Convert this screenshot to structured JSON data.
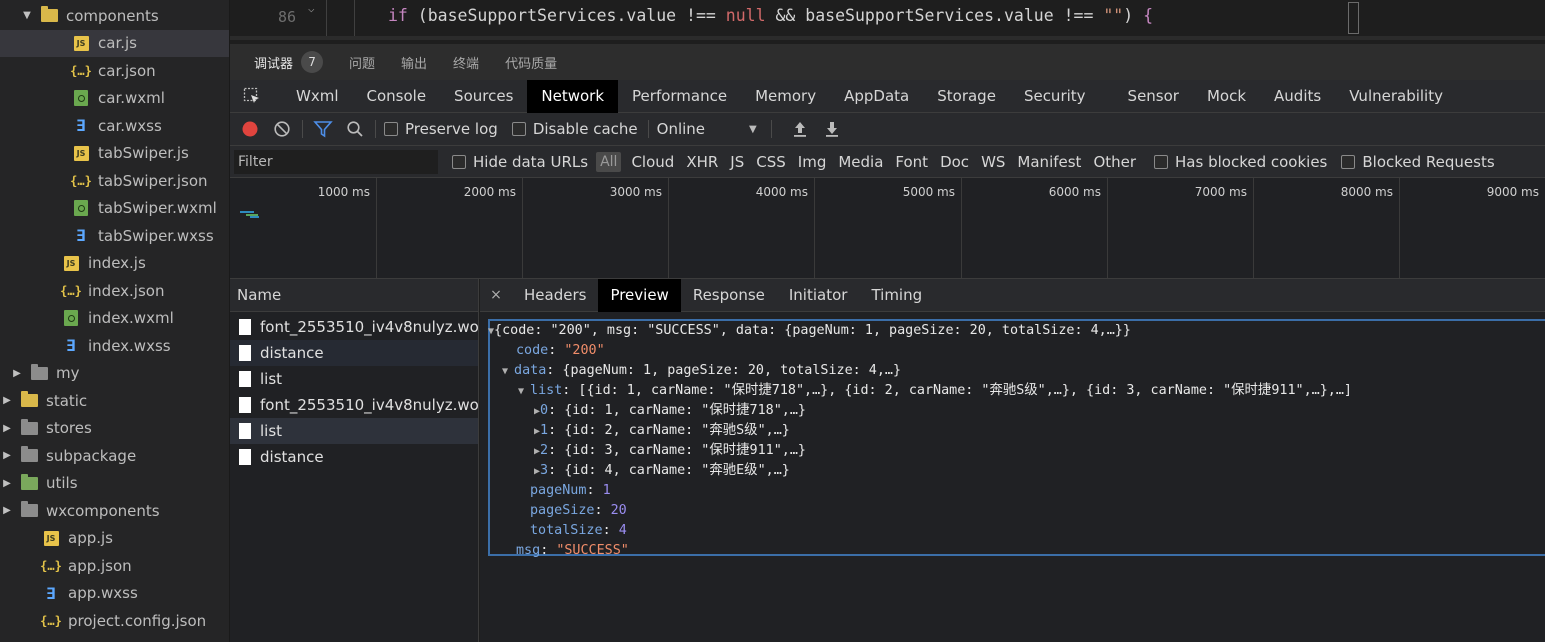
{
  "explorer": {
    "items": [
      {
        "label": "components",
        "type": "folder-yellow",
        "expanded": true
      },
      {
        "label": "car.js",
        "type": "js"
      },
      {
        "label": "car.json",
        "type": "json"
      },
      {
        "label": "car.wxml",
        "type": "wxml"
      },
      {
        "label": "car.wxss",
        "type": "wxss"
      },
      {
        "label": "tabSwiper.js",
        "type": "js"
      },
      {
        "label": "tabSwiper.json",
        "type": "json"
      },
      {
        "label": "tabSwiper.wxml",
        "type": "wxml"
      },
      {
        "label": "tabSwiper.wxss",
        "type": "wxss"
      },
      {
        "label": "index.js",
        "type": "js"
      },
      {
        "label": "index.json",
        "type": "json"
      },
      {
        "label": "index.wxml",
        "type": "wxml"
      },
      {
        "label": "index.wxss",
        "type": "wxss"
      },
      {
        "label": "my",
        "type": "folder"
      },
      {
        "label": "static",
        "type": "folder-yellow"
      },
      {
        "label": "stores",
        "type": "folder"
      },
      {
        "label": "subpackage",
        "type": "folder"
      },
      {
        "label": "utils",
        "type": "folder-green"
      },
      {
        "label": "wxcomponents",
        "type": "folder"
      },
      {
        "label": "app.js",
        "type": "js"
      },
      {
        "label": "app.json",
        "type": "json"
      },
      {
        "label": "app.wxss",
        "type": "wxss"
      },
      {
        "label": "project.config.json",
        "type": "json"
      }
    ]
  },
  "editor": {
    "line_number": "86",
    "code_tokens": {
      "kw": "if",
      "open": " (",
      "var1": "baseSupportServices.value",
      "op1": " !== ",
      "null": "null",
      "and": " && ",
      "var2": "baseSupportServices.value",
      "op2": " !== ",
      "str": "\"\"",
      "close": ") ",
      "brace": "{"
    }
  },
  "devtools_tabs": [
    {
      "label": "调试器",
      "badge": "7",
      "active": true
    },
    {
      "label": "问题"
    },
    {
      "label": "输出"
    },
    {
      "label": "终端"
    },
    {
      "label": "代码质量"
    }
  ],
  "panel_tabs": [
    "Wxml",
    "Console",
    "Sources",
    "Network",
    "Performance",
    "Memory",
    "AppData",
    "Storage",
    "Security",
    "Sensor",
    "Mock",
    "Audits",
    "Vulnerability"
  ],
  "active_panel": "Network",
  "toolbar": {
    "preserve_log": "Preserve log",
    "disable_cache": "Disable cache",
    "throttle": "Online"
  },
  "filter": {
    "placeholder": "Filter",
    "hide_data_urls": "Hide data URLs",
    "types": [
      "All",
      "Cloud",
      "XHR",
      "JS",
      "CSS",
      "Img",
      "Media",
      "Font",
      "Doc",
      "WS",
      "Manifest",
      "Other"
    ],
    "has_blocked_cookies": "Has blocked cookies",
    "blocked_requests": "Blocked Requests"
  },
  "timeline": {
    "labels": [
      "1000 ms",
      "2000 ms",
      "3000 ms",
      "4000 ms",
      "5000 ms",
      "6000 ms",
      "7000 ms",
      "8000 ms",
      "9000 ms"
    ]
  },
  "requests": {
    "header": "Name",
    "rows": [
      "font_2553510_iv4v8nulyz.woff…",
      "distance",
      "list",
      "font_2553510_iv4v8nulyz.woff…",
      "list",
      "distance"
    ]
  },
  "detail": {
    "tabs": [
      "Headers",
      "Preview",
      "Response",
      "Initiator",
      "Timing"
    ],
    "active_tab": "Preview",
    "close": "×"
  },
  "preview": {
    "root_summary": "{code: \"200\", msg: \"SUCCESS\", data: {pageNum: 1, pageSize: 20, totalSize: 4,…}}",
    "code_key": "code",
    "code_val": "\"200\"",
    "data_key": "data",
    "data_summary": "{pageNum: 1, pageSize: 20, totalSize: 4,…}",
    "list_key": "list",
    "list_summary": "[{id: 1, carName: \"保时捷718\",…}, {id: 2, carName: \"奔驰S级\",…}, {id: 3, carName: \"保时捷911\",…},…]",
    "list_items": [
      {
        "index": "0",
        "summary": "{id: 1, carName: \"保时捷718\",…}"
      },
      {
        "index": "1",
        "summary": "{id: 2, carName: \"奔驰S级\",…}"
      },
      {
        "index": "2",
        "summary": "{id: 3, carName: \"保时捷911\",…}"
      },
      {
        "index": "3",
        "summary": "{id: 4, carName: \"奔驰E级\",…}"
      }
    ],
    "page_num_key": "pageNum",
    "page_num_val": "1",
    "page_size_key": "pageSize",
    "page_size_val": "20",
    "total_size_key": "totalSize",
    "total_size_val": "4",
    "msg_key": "msg",
    "msg_val": "\"SUCCESS\""
  },
  "colors": {
    "accent": "#3b6ea8",
    "record": "#e0443e",
    "filter_active": "#4d8ee8",
    "json_key": "#7aa7e0",
    "json_string": "#f08d6a",
    "json_number": "#9a8df0"
  }
}
